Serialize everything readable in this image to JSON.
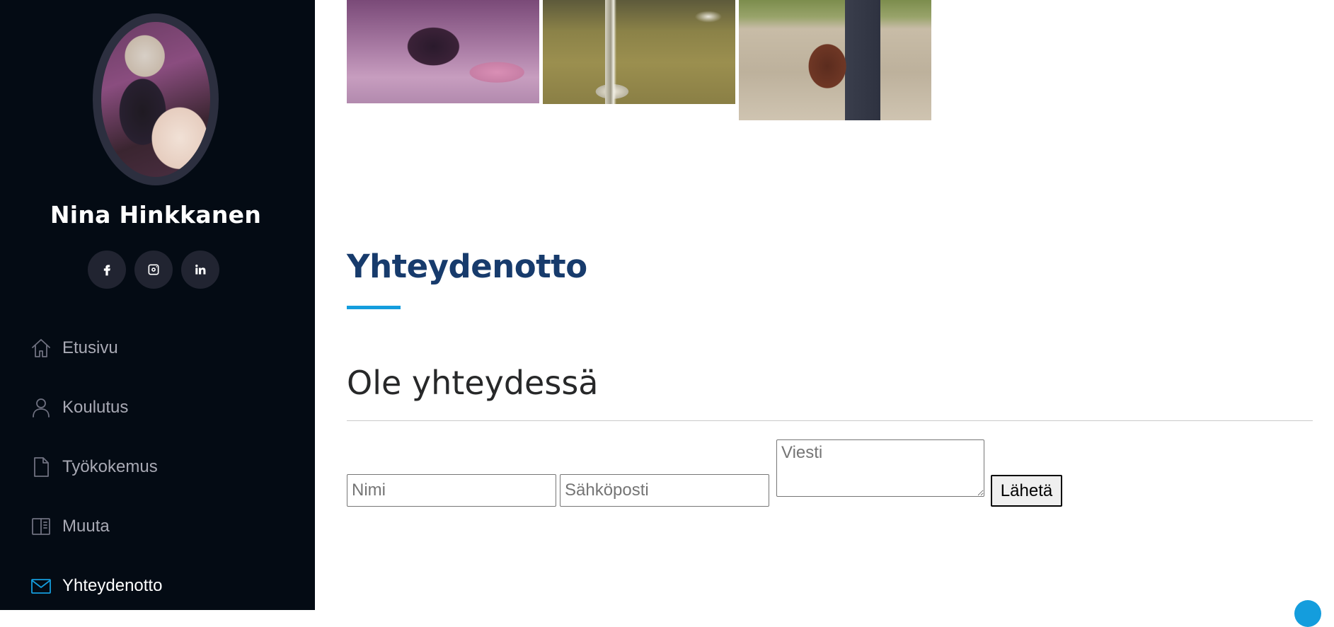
{
  "profile": {
    "name": "Nina Hinkkanen"
  },
  "social": [
    {
      "name": "facebook",
      "icon": "facebook-icon"
    },
    {
      "name": "instagram",
      "icon": "instagram-icon"
    },
    {
      "name": "linkedin",
      "icon": "linkedin-icon"
    }
  ],
  "nav": {
    "items": [
      {
        "label": "Etusivu",
        "icon": "home-icon"
      },
      {
        "label": "Koulutus",
        "icon": "person-icon"
      },
      {
        "label": "Työkokemus",
        "icon": "file-icon"
      },
      {
        "label": "Muuta",
        "icon": "book-icon"
      },
      {
        "label": "Yhteydenotto",
        "icon": "envelope-icon",
        "active": true
      }
    ]
  },
  "section": {
    "title": "Yhteydenotto",
    "subtitle": "Ole yhteydessä"
  },
  "form": {
    "name_placeholder": "Nimi",
    "email_placeholder": "Sähköposti",
    "message_placeholder": "Viesti",
    "submit_label": "Lähetä"
  },
  "colors": {
    "sidebar_bg": "#040b14",
    "accent": "#149ddd",
    "title": "#173b6c"
  }
}
